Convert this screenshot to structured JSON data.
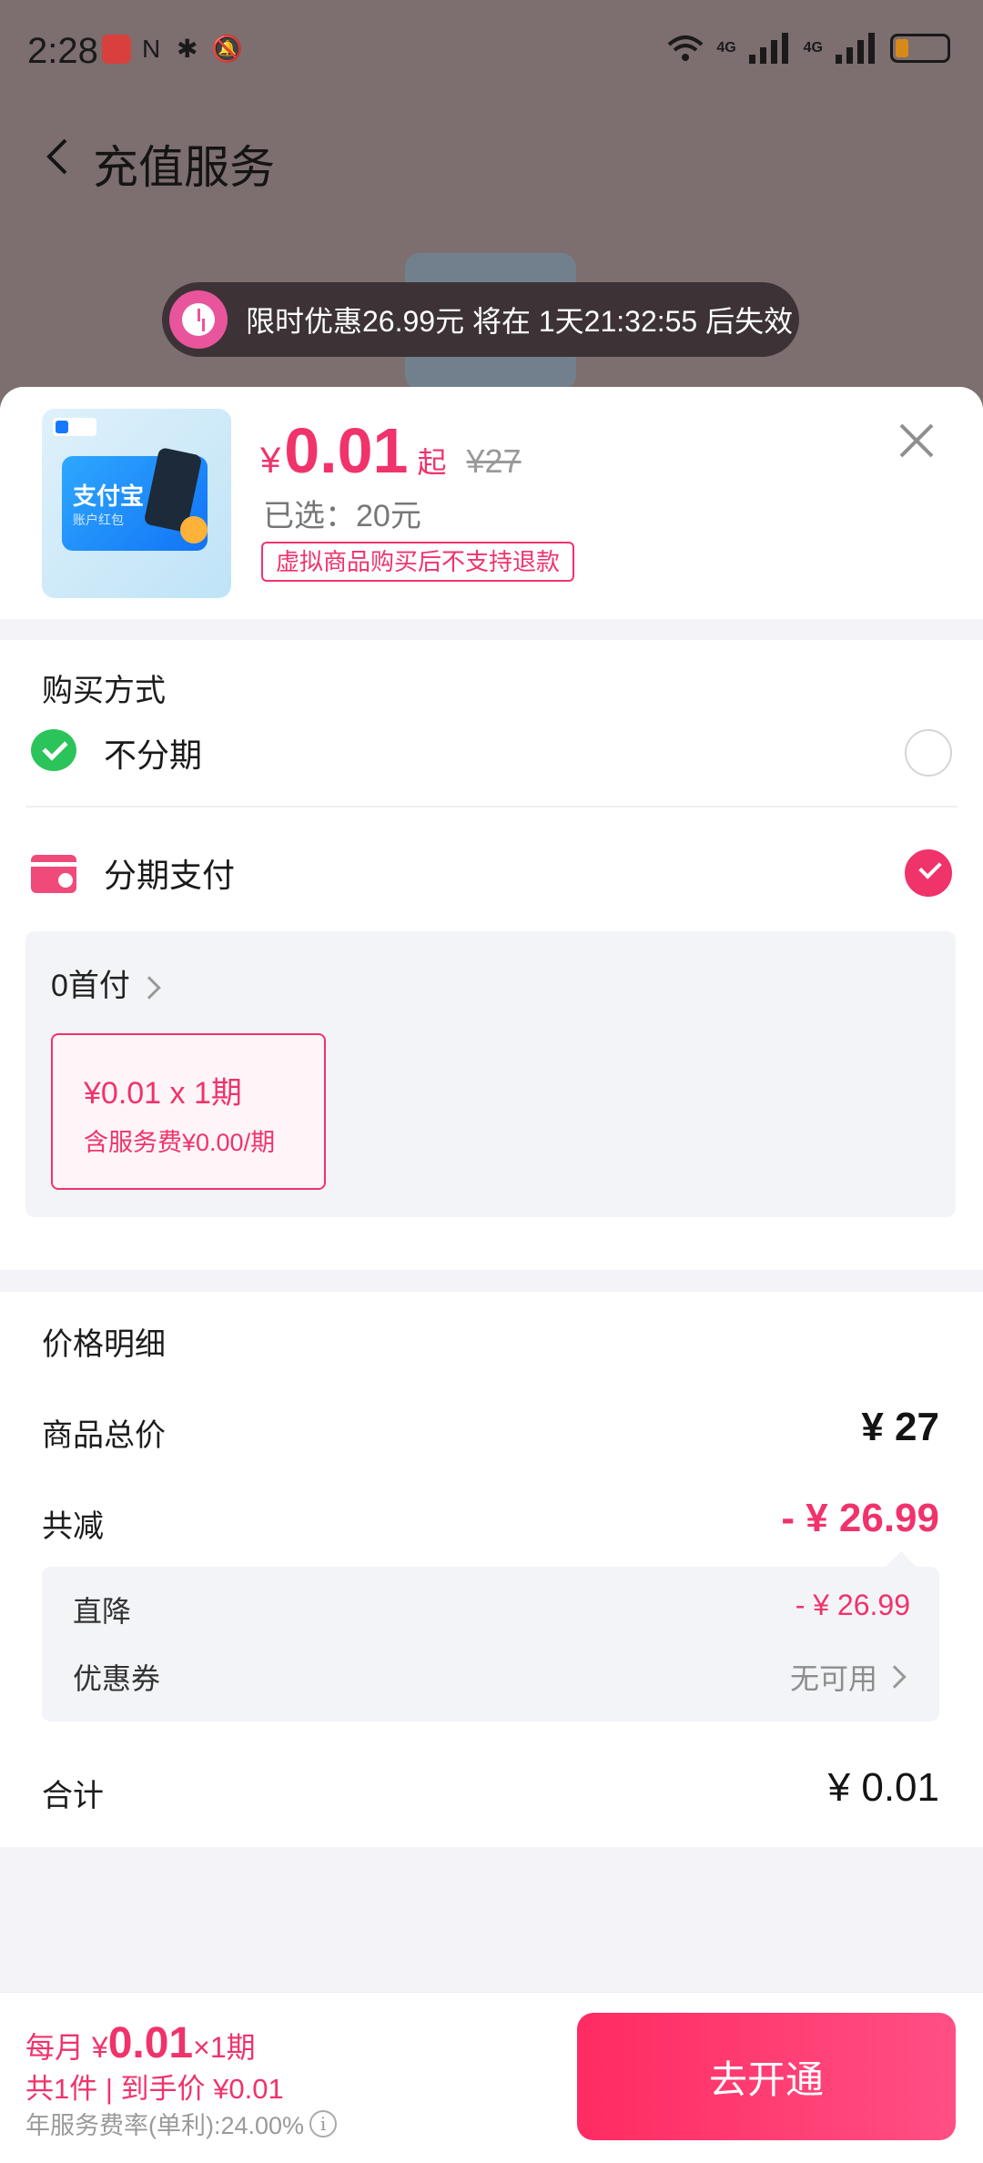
{
  "status": {
    "time": "2:28",
    "net1": "4G",
    "net2": "4G"
  },
  "header": {
    "title": "充值服务"
  },
  "promo": {
    "text": "限时优惠26.99元 将在 1天21:32:55 后失效"
  },
  "product": {
    "thumb_title": "支付宝",
    "thumb_sub": "账户红包",
    "currency": "¥",
    "price": "0.01",
    "from_label": "起",
    "original_price": "¥27",
    "selected": "已选：20元",
    "notice": "虚拟商品购买后不支持退款"
  },
  "payment": {
    "title": "购买方式",
    "methods": [
      {
        "label": "不分期",
        "selected": false
      },
      {
        "label": "分期支付",
        "selected": true
      }
    ],
    "down_payment": "0首付",
    "plan": {
      "line1": "¥0.01 x 1期",
      "line2": "含服务费¥0.00/期"
    }
  },
  "details": {
    "title": "价格明细",
    "total_label": "商品总价",
    "total_value": "¥ 27",
    "discount_label": "共减",
    "discount_value": "- ¥ 26.99",
    "direct_label": "直降",
    "direct_value": "- ¥ 26.99",
    "coupon_label": "优惠券",
    "coupon_value": "无可用",
    "sum_label": "合计",
    "sum_value": "¥ 0.01"
  },
  "footer": {
    "monthly_prefix": "每月 ¥",
    "monthly_amount": "0.01",
    "monthly_suffix": "×1期",
    "summary": "共1件 | 到手价 ¥0.01",
    "rate": "年服务费率(单利):24.00%",
    "cta": "去开通"
  },
  "colors": {
    "accent": "#f0336b",
    "wechat": "#2bc45a",
    "cta": "#ff2b62"
  }
}
